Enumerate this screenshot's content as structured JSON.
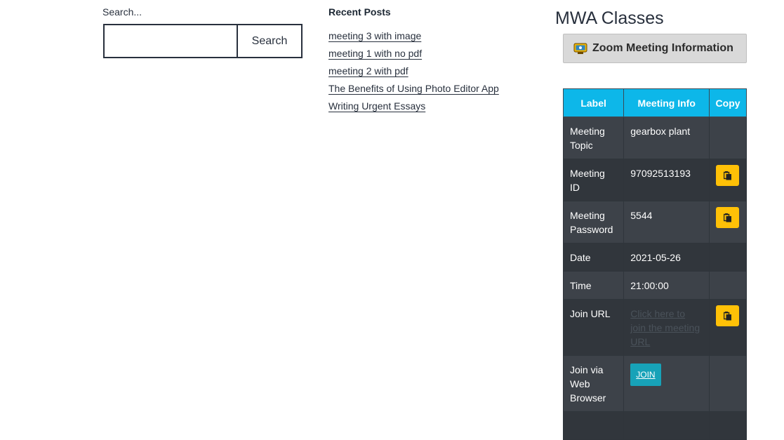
{
  "search": {
    "label": "Search...",
    "placeholder": "",
    "button_label": "Search"
  },
  "recent_posts": {
    "title": "Recent Posts",
    "items": [
      {
        "label": "meeting 3 with image"
      },
      {
        "label": "meeting 1 with no pdf"
      },
      {
        "label": "meeting 2 with pdf"
      },
      {
        "label": "The Benefits of Using Photo Editor App"
      },
      {
        "label": "Writing Urgent Essays"
      }
    ]
  },
  "mwa": {
    "title": "MWA Classes",
    "zoom_button_label": "Zoom Meeting Information",
    "zoom_icon": "zoom-meeting-icon",
    "table": {
      "headers": [
        "Label",
        "Meeting Info",
        "Copy"
      ],
      "rows": [
        {
          "label": "Meeting Topic",
          "value": "gearbox plant"
        },
        {
          "label": "Meeting ID",
          "value": "97092513193",
          "copy": true
        },
        {
          "label": "Meeting Password",
          "value": "5544",
          "copy": true
        },
        {
          "label": "Date",
          "value": "2021-05-26"
        },
        {
          "label": "Time",
          "value": "21:00:00"
        },
        {
          "label": "Join URL",
          "value": "Click here to join the meeting URL",
          "copy": true
        },
        {
          "label": "Join via Web Browser",
          "value": "JOIN"
        }
      ]
    },
    "colors": {
      "header_bg": "#0db7e9",
      "row_dark": "#31363c",
      "row_light": "#3d4249",
      "copy_button": "#ffc107",
      "join_button": "#17a2b8"
    },
    "copy_icon": "copy-icon"
  }
}
